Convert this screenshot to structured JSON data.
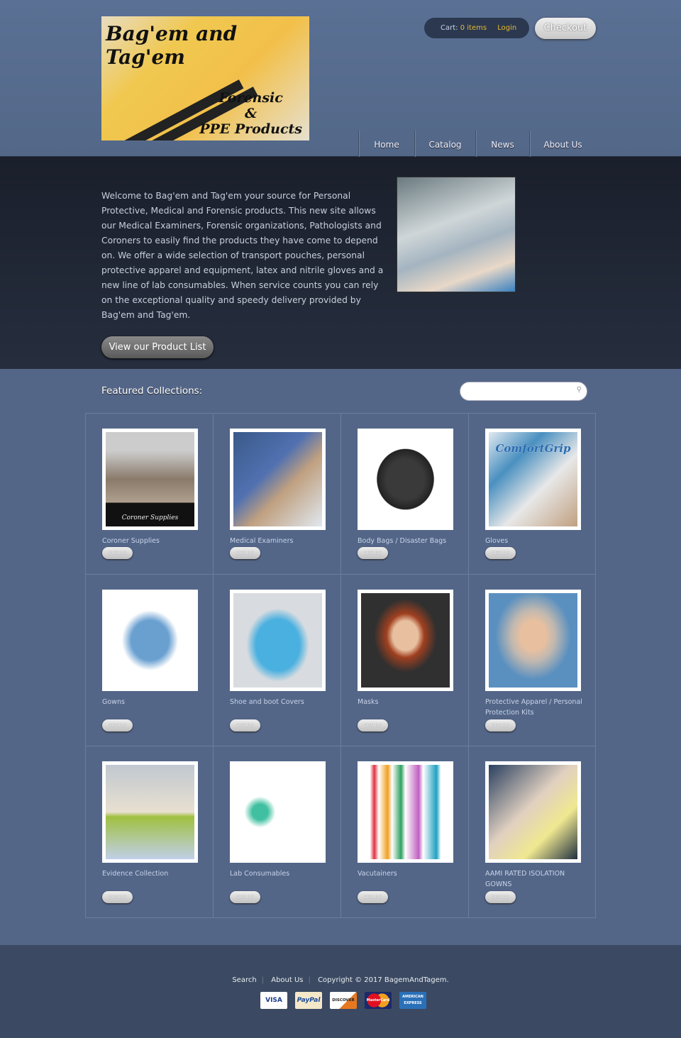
{
  "header": {
    "logo_text": "Bag'em and Tag'em",
    "logo_sub": [
      "Forensic",
      "&",
      "PPE Products"
    ],
    "cart_label": "Cart:",
    "cart_items": "0 items",
    "login": "Login",
    "checkout": "Checkout",
    "nav": [
      {
        "label": "Home"
      },
      {
        "label": "Catalog"
      },
      {
        "label": "News"
      },
      {
        "label": "About Us"
      }
    ]
  },
  "hero": {
    "text": "Welcome to Bag'em and Tag'em your source for Personal Protective, Medical and Forensic products. This new site allows our Medical Examiners, Forensic organizations, Pathologists and Coroners to easily find the products they have come to depend on. We offer a wide selection of transport pouches, personal protective apparel and equipment, latex and nitrile gloves and a new line of lab consumables. When service counts you can rely on the exceptional quality and speedy delivery provided by Bag'em and Tag'em.",
    "button": "View our Product List"
  },
  "featured": {
    "title": "Featured Collections:",
    "search_placeholder": "",
    "details_label": "DETAILS",
    "collections": [
      {
        "name": "Coroner Supplies",
        "img_caption": "Coroner Supplies"
      },
      {
        "name": "Medical Examiners"
      },
      {
        "name": "Body Bags / Disaster Bags"
      },
      {
        "name": "Gloves",
        "img_caption": "ComfortGrip"
      },
      {
        "name": "Gowns"
      },
      {
        "name": "Shoe and boot Covers"
      },
      {
        "name": "Masks"
      },
      {
        "name": "Protective Apparel / Personal Protection Kits"
      },
      {
        "name": "Evidence Collection"
      },
      {
        "name": "Lab Consumables"
      },
      {
        "name": "Vacutainers"
      },
      {
        "name": "AAMI RATED ISOLATION GOWNS"
      }
    ]
  },
  "footer": {
    "links": [
      "Search",
      "About Us"
    ],
    "copyright": "Copyright © 2017 BagemAndTagem.",
    "cards": [
      "VISA",
      "PayPal",
      "DISCOVER",
      "MasterCard",
      "AMERICAN EXPRESS"
    ]
  }
}
